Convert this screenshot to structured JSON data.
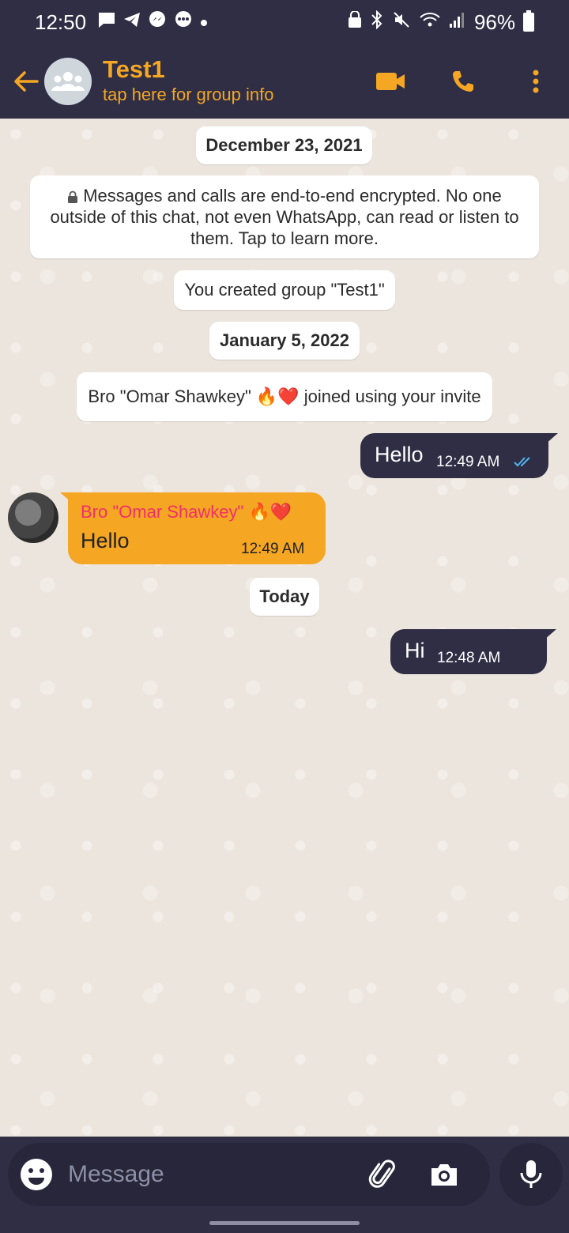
{
  "status_bar": {
    "time": "12:50",
    "battery": "96%"
  },
  "header": {
    "title": "Test1",
    "subtitle": "tap here for group info"
  },
  "chat": {
    "date1": "December 23, 2021",
    "encryption_notice": "Messages and calls are end-to-end encrypted. No one outside of this chat, not even WhatsApp, can read or listen to them. Tap to learn more.",
    "created_notice": "You created group \"Test1\"",
    "date2": "January 5, 2022",
    "joined_notice": "Bro \"Omar Shawkey\" 🔥❤️ joined using your invite",
    "msg1": {
      "text": "Hello",
      "time": "12:49 AM"
    },
    "msg2": {
      "sender": "Bro \"Omar Shawkey\" 🔥❤️",
      "text": "Hello",
      "time": "12:49 AM"
    },
    "date3": "Today",
    "msg3": {
      "text": "Hi",
      "time": "12:48 AM"
    }
  },
  "input": {
    "placeholder": "Message"
  },
  "colors": {
    "accent": "#f5a623",
    "bar": "#2f2e45",
    "sender_name": "#f0306a",
    "read_ticks": "#4fb6ec"
  }
}
